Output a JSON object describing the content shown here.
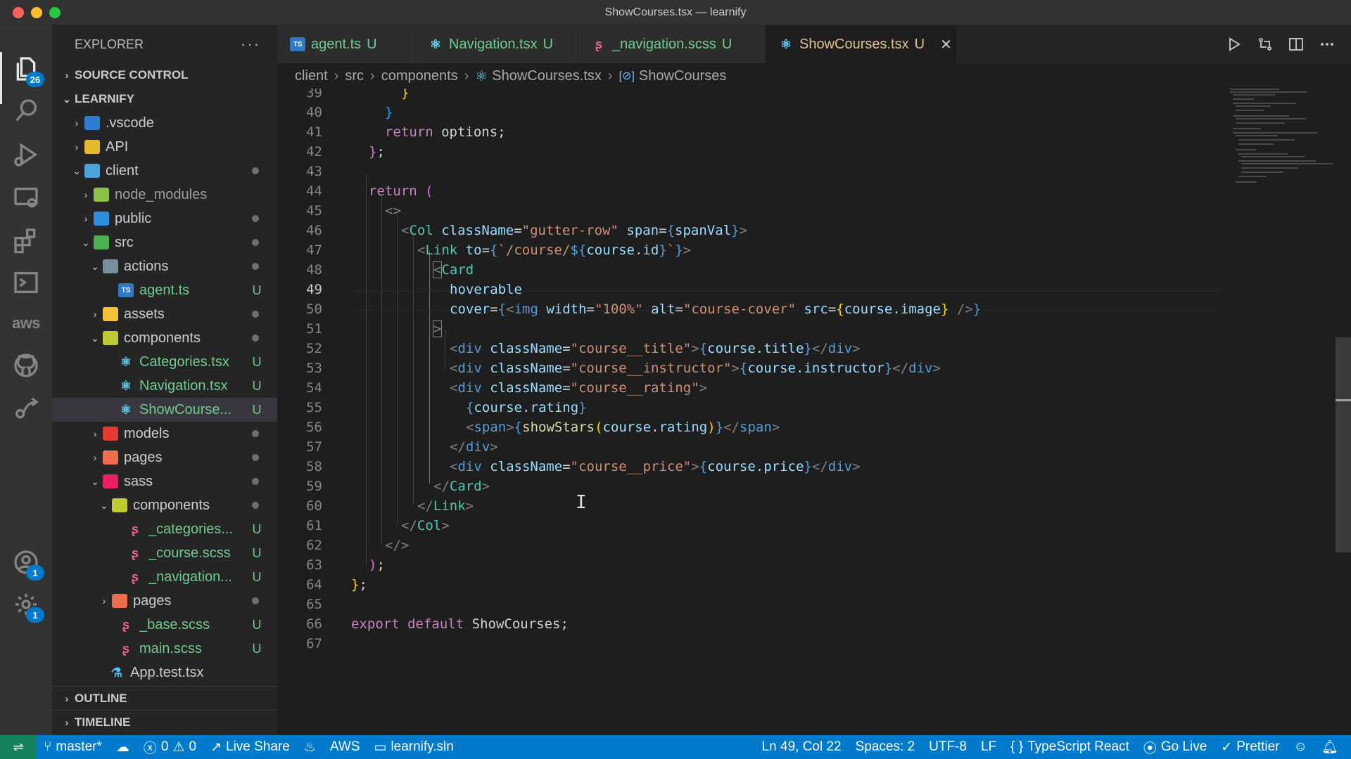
{
  "window": {
    "title": "ShowCourses.tsx — learnify"
  },
  "activity_bar": {
    "explorer_badge": "26",
    "accounts_badge": "1",
    "settings_badge": "1",
    "aws_label": "aws"
  },
  "sidebar": {
    "header": "EXPLORER",
    "source_control": "SOURCE CONTROL",
    "project": "LEARNIFY",
    "tree": [
      {
        "name": ".vscode",
        "status": ""
      },
      {
        "name": "API",
        "status": ""
      },
      {
        "name": "client",
        "status": "dot"
      },
      {
        "name": "node_modules",
        "status": ""
      },
      {
        "name": "public",
        "status": "dot"
      },
      {
        "name": "src",
        "status": "dot"
      },
      {
        "name": "actions",
        "status": "dot"
      },
      {
        "name": "agent.ts",
        "status": "U"
      },
      {
        "name": "assets",
        "status": "dot"
      },
      {
        "name": "components",
        "status": "dot"
      },
      {
        "name": "Categories.tsx",
        "status": "U"
      },
      {
        "name": "Navigation.tsx",
        "status": "U"
      },
      {
        "name": "ShowCourse...",
        "status": "U"
      },
      {
        "name": "models",
        "status": "dot"
      },
      {
        "name": "pages",
        "status": "dot"
      },
      {
        "name": "sass",
        "status": "dot"
      },
      {
        "name": "components",
        "status": "dot"
      },
      {
        "name": "_categories...",
        "status": "U"
      },
      {
        "name": "_course.scss",
        "status": "U"
      },
      {
        "name": "_navigation...",
        "status": "U"
      },
      {
        "name": "pages",
        "status": "dot"
      },
      {
        "name": "_base.scss",
        "status": "U"
      },
      {
        "name": "main.scss",
        "status": "U"
      },
      {
        "name": "App.test.tsx",
        "status": ""
      }
    ],
    "outline": "OUTLINE",
    "timeline": "TIMELINE"
  },
  "tabs": [
    {
      "label": "agent.ts",
      "status": "U"
    },
    {
      "label": "Navigation.tsx",
      "status": "U"
    },
    {
      "label": "_navigation.scss",
      "status": "U"
    },
    {
      "label": "ShowCourses.tsx",
      "status": "U"
    }
  ],
  "breadcrumb": [
    "client",
    "src",
    "components",
    "ShowCourses.tsx",
    "ShowCourses"
  ],
  "editor": {
    "line_numbers": [
      "39",
      "40",
      "41",
      "42",
      "43",
      "44",
      "45",
      "46",
      "47",
      "48",
      "49",
      "50",
      "51",
      "52",
      "53",
      "54",
      "55",
      "56",
      "57",
      "58",
      "59",
      "60",
      "61",
      "62",
      "63",
      "64",
      "65",
      "66",
      "67"
    ],
    "active_line": "49",
    "code": {
      "l41_kw": "return",
      "l41_rest": " options;",
      "l44_kw": "return",
      "l46_tag": "Col",
      "l46_attr1": "className",
      "l46_val1": "\"gutter-row\"",
      "l46_attr2": "span",
      "l46_expr": "spanVal",
      "l47_tag": "Link",
      "l47_attr": "to",
      "l47_tpl": "/course/",
      "l47_expr": "course.id",
      "l48_tag": "Card",
      "l49_attr": "hoverable",
      "l50_attr": "cover",
      "l50_tag": "img",
      "l50_a1": "width",
      "l50_v1": "\"100%\"",
      "l50_a2": "alt",
      "l50_v2": "\"course-cover\"",
      "l50_a3": "src",
      "l50_expr": "course.image",
      "div": "div",
      "span": "span",
      "className": "className",
      "l52_val": "\"course__title\"",
      "l52_expr": "course.title",
      "l53_val": "\"course__instructor\"",
      "l53_expr": "course.instructor",
      "l54_val": "\"course__rating\"",
      "l55_expr": "course.rating",
      "l56_fn": "showStars",
      "l56_arg": "course.rating",
      "l58_val": "\"course__price\"",
      "l58_expr": "course.price",
      "l59_tag": "Card",
      "l60_tag": "Link",
      "l61_tag": "Col",
      "l66_kw1": "export",
      "l66_kw2": "default",
      "l66_id": "ShowCourses;"
    }
  },
  "status_bar": {
    "branch": "master*",
    "errors": "0",
    "warnings": "0",
    "live_share": "Live Share",
    "aws": "AWS",
    "solution": "learnify.sln",
    "position": "Ln 49, Col 22",
    "spaces": "Spaces: 2",
    "encoding": "UTF-8",
    "eol": "LF",
    "language": "TypeScript React",
    "go_live": "Go Live",
    "prettier": "Prettier"
  },
  "colors": {
    "accent": "#007acc",
    "untracked": "#73c991",
    "modified_tab": "#e2c08d"
  }
}
